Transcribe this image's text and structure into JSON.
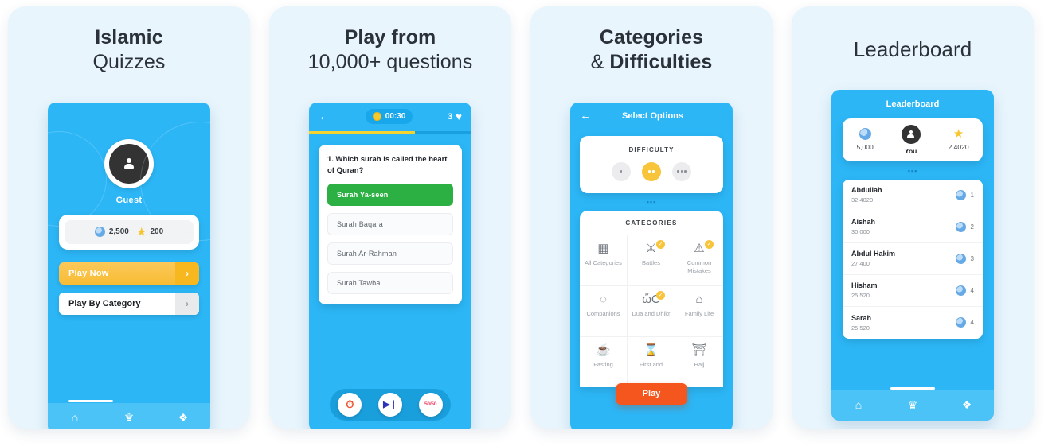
{
  "cards": [
    {
      "title_line1": "Islamic",
      "title_line2": "Quizzes"
    },
    {
      "title_line1": "Play from",
      "title_line2": "10,000+ questions"
    },
    {
      "title_line1": "Categories",
      "title_line2_prefix": "& ",
      "title_line2_bold": "Difficulties"
    },
    {
      "title_line1": "Leaderboard"
    }
  ],
  "home": {
    "user_name": "Guest",
    "coins": "2,500",
    "stars": "200",
    "play_now_label": "Play Now",
    "play_now_arrow": "›",
    "play_by_category_label": "Play By Category",
    "play_by_category_arrow": "›",
    "nav": [
      {
        "name": "home",
        "glyph": "⌂"
      },
      {
        "name": "trophy",
        "glyph": "♕"
      },
      {
        "name": "settings",
        "glyph": "⚙"
      }
    ]
  },
  "quiz": {
    "back_glyph": "←",
    "timer": "00:30",
    "lives_count": "3",
    "heart_glyph": "♥",
    "progress_percent": 65,
    "question": "1. Which surah is called the heart of Quran?",
    "options": [
      {
        "label": "Surah Ya-seen",
        "state": "correct"
      },
      {
        "label": "Surah Baqara",
        "state": "default"
      },
      {
        "label": "Surah Ar-Rahman",
        "state": "default"
      },
      {
        "label": "Surah Tawba",
        "state": "default"
      }
    ],
    "tools": [
      {
        "name": "mute-timer",
        "glyph": "⏱",
        "kind": "mute"
      },
      {
        "name": "skip-question",
        "glyph": "▶❘",
        "kind": "skip"
      },
      {
        "name": "fifty-fifty",
        "glyph": "50/50",
        "kind": "fifty"
      }
    ]
  },
  "options_screen": {
    "back_glyph": "←",
    "title": "Select Options",
    "difficulty_heading": "DIFFICULTY",
    "difficulty_levels": [
      {
        "dots": 1,
        "selected": false
      },
      {
        "dots": 2,
        "selected": true
      },
      {
        "dots": 3,
        "selected": false
      }
    ],
    "drag_handle": "▪▪▪",
    "categories_heading": "CATEGORIES",
    "categories": [
      {
        "label": "All Categories",
        "icon": "▦",
        "checked": false
      },
      {
        "label": "Battles",
        "icon": "⚔",
        "checked": true
      },
      {
        "label": "Common Mistakes",
        "icon": "⚠",
        "checked": true
      },
      {
        "label": "Companions",
        "icon": "◌",
        "checked": false
      },
      {
        "label": "Dua and Dhikr",
        "icon": "ὤC",
        "checked": true
      },
      {
        "label": "Family Life",
        "icon": "⌂",
        "checked": false
      },
      {
        "label": "Fasting",
        "icon": "☕",
        "checked": false
      },
      {
        "label": "First and",
        "icon": "⌛",
        "checked": false
      },
      {
        "label": "Hajj",
        "icon": "⛩",
        "checked": false
      }
    ],
    "play_button": "Play"
  },
  "leaderboard": {
    "title": "Leaderboard",
    "me": {
      "coins": "5,000",
      "name": "You",
      "stars": "2,4020"
    },
    "drag_handle": "▪▪▪",
    "rows": [
      {
        "name": "Abdullah",
        "score": "32,4020",
        "rank": "1"
      },
      {
        "name": "Aishah",
        "score": "30,000",
        "rank": "2"
      },
      {
        "name": "Abdul Hakim",
        "score": "27,400",
        "rank": "3"
      },
      {
        "name": "Hisham",
        "score": "25,520",
        "rank": "4"
      },
      {
        "name": "Sarah",
        "score": "25,520",
        "rank": "4"
      }
    ],
    "nav": [
      {
        "name": "home",
        "glyph": "⌂"
      },
      {
        "name": "trophy",
        "glyph": "♕"
      },
      {
        "name": "settings",
        "glyph": "⚙"
      }
    ]
  },
  "colors": {
    "brand_blue": "#2cb6f6",
    "card_bg": "#e8f5fd",
    "accent_yellow": "#f8c43a",
    "correct_green": "#2cb043",
    "play_orange": "#f4561d",
    "dark": "#333333"
  }
}
